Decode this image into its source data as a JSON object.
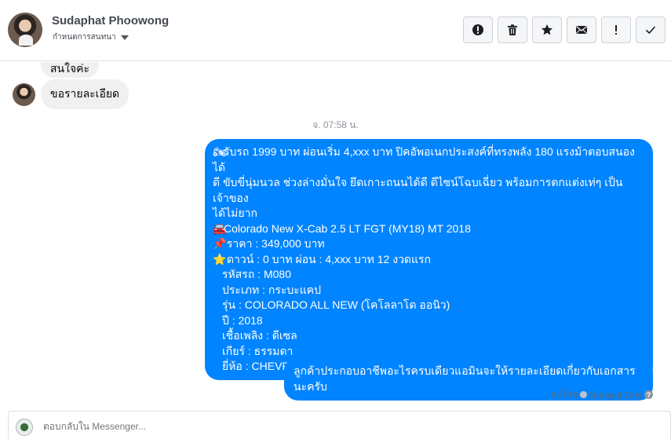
{
  "header": {
    "contact_name": "Sudaphat Phoowong",
    "status_label": "กำหนดการสนทนา",
    "actions": [
      {
        "name": "mark-spam-button",
        "icon": "alert-circle-icon"
      },
      {
        "name": "delete-button",
        "icon": "trash-icon"
      },
      {
        "name": "star-button",
        "icon": "star-icon"
      },
      {
        "name": "mark-unread-button",
        "icon": "envelope-icon"
      },
      {
        "name": "important-button",
        "icon": "exclamation-icon"
      },
      {
        "name": "mark-done-button",
        "icon": "check-icon"
      }
    ]
  },
  "conversation": {
    "incoming_partial": "สนใจค่ะ",
    "incoming_detail": "ขอรายละเอียด",
    "timestamp": "จ. 07:58 น.",
    "outgoing_long": {
      "lines": [
        {
          "emoji": "🏍",
          "text": "รับรถ 1999 บาท ผ่อนเริ่ม 4,xxx บาท ปิคอัพอเนกประสงค์ที่ทรงพลัง 180 แรงม้าตอบสนองได้"
        },
        {
          "emoji": "",
          "text": "ดี ขับขี่นุ่มนวล ช่วงล่างมั่นใจ ยึดเกาะถนนได้ดี ดีไซน์โฉบเฉี่ยว พร้อมการตกแต่งเท่ๆ เป็นเจ้าของ"
        },
        {
          "emoji": "",
          "text": "ได้ไม่ยาก"
        },
        {
          "emoji": "🚘",
          "text": "Colorado New X-Cab 2.5 LT FGT (MY18) MT 2018"
        },
        {
          "emoji": "📌",
          "text": " ราคา : 349,000 บาท"
        },
        {
          "emoji": "⭐",
          "text": " ดาวน์ : 0 บาท ผ่อน : 4,xxx บาท 12 งวดแรก"
        }
      ],
      "specs": [
        "รหัสรถ : M080",
        "ประเภท : กระบะแคป",
        "รุ่น : COLORADO ALL NEW (โคโลลาโด ออนิว)",
        "ปี : 2018",
        "เชื้อเพลิง : ดีเซล",
        "เกียร์ : ธรรมดา",
        "ยี่ห้อ : CHEVROLET ( เชฟโรเลต )"
      ]
    },
    "outgoing_short": "ลูกค้าประกอบอาชีพอะไรครบเดียวแอมินจะให้รายละเอียดเกี่ยวกับเอกสารนะครับ",
    "sent_by": "ส่งโดย",
    "sender_name": "Surayut Ons"
  },
  "composer": {
    "placeholder": "ตอบกลับใน Messenger..."
  },
  "colors": {
    "outgoing_bubble": "#0084ff",
    "incoming_bubble": "#f0f0f0"
  }
}
